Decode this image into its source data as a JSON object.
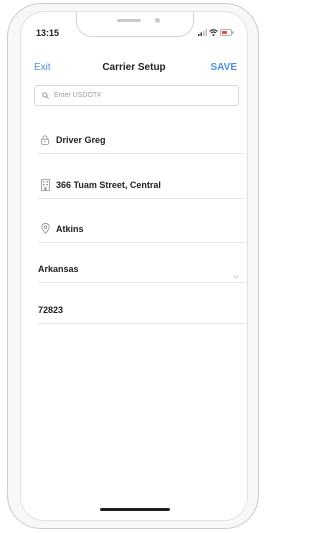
{
  "status_bar": {
    "time": "13:15",
    "icons": [
      "signal-icon",
      "wifi-icon",
      "battery-icon"
    ]
  },
  "nav": {
    "exit_label": "Exit",
    "title": "Carrier Setup",
    "save_label": "SAVE"
  },
  "search": {
    "placeholder": "Enter USDOT#",
    "value": ""
  },
  "form": {
    "name": "Driver Greg",
    "street": "366 Tuam Street, Central",
    "city": "Atkins",
    "state": "Arkansas",
    "zip": "72823"
  },
  "colors": {
    "accent": "#4a90e2",
    "text": "#1e1e1e",
    "divider": "#e4e6e9"
  }
}
